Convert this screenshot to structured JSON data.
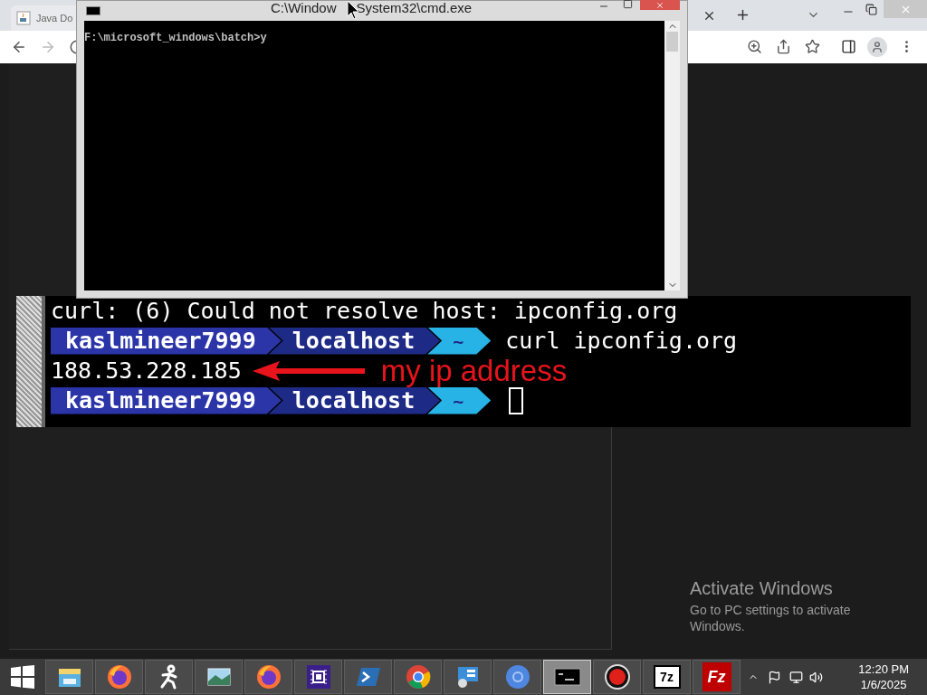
{
  "browser": {
    "tab": {
      "title": "Java Do"
    }
  },
  "cmd_window": {
    "title_parts": [
      "C:\\Window",
      "System32\\cmd.exe"
    ],
    "lines": [
      "F:\\microsoft_windows\\batch>y"
    ]
  },
  "terminal": {
    "lines": [
      {
        "kind": "output",
        "text": "curl: (6) Could not resolve host: ipconfig.org"
      },
      {
        "kind": "prompt",
        "user": "kaslmineer7999",
        "host": "localhost",
        "dir": "~",
        "command": "curl ipconfig.org"
      },
      {
        "kind": "output",
        "text": "188.53.228.185",
        "annotation": "my ip address"
      },
      {
        "kind": "prompt",
        "user": "kaslmineer7999",
        "host": "localhost",
        "dir": "~",
        "cursor": true
      }
    ]
  },
  "activation_notice": {
    "title": "Activate Windows",
    "text": "Go to PC settings to activate Windows."
  },
  "taskbar": {
    "apps": [
      {
        "kind": "explorer",
        "selected": false
      },
      {
        "kind": "firefox",
        "selected": false
      },
      {
        "kind": "runner",
        "selected": false
      },
      {
        "kind": "photos",
        "selected": false
      },
      {
        "kind": "firefox",
        "selected": false
      },
      {
        "kind": "chip",
        "selected": false
      },
      {
        "kind": "powershell",
        "selected": false
      },
      {
        "kind": "chrome",
        "selected": false
      },
      {
        "kind": "network",
        "selected": false
      },
      {
        "kind": "chromium",
        "selected": false
      },
      {
        "kind": "console",
        "selected": true
      },
      {
        "kind": "record",
        "selected": false
      },
      {
        "kind": "sevenzip",
        "selected": false,
        "label": "7z"
      },
      {
        "kind": "filezilla",
        "selected": false,
        "label": "Fz"
      }
    ],
    "clock": {
      "time": "12:20 PM",
      "date": "1/6/2025"
    }
  }
}
